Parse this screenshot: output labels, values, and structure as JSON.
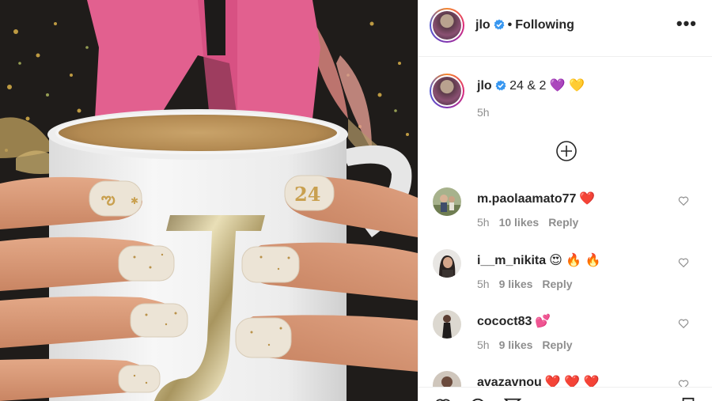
{
  "post": {
    "author": "jlo",
    "follow_status": "Following",
    "separator": "•",
    "more_glyph": "•••",
    "caption_text": "24 & 2 💜 💛",
    "caption_time": "5h"
  },
  "comments": [
    {
      "username": "m.paolaamato77",
      "emoji": "❤️",
      "time": "5h",
      "likes": "10 likes",
      "reply": "Reply"
    },
    {
      "username": "i__m_nikita",
      "emoji": "😍 🔥 🔥",
      "time": "5h",
      "likes": "9 likes",
      "reply": "Reply"
    },
    {
      "username": "cococt83",
      "emoji": "💕",
      "time": "5h",
      "likes": "9 likes",
      "reply": "Reply"
    },
    {
      "username": "avazavnou",
      "emoji": "❤️ ❤️ ❤️",
      "time": "",
      "likes": "",
      "reply": ""
    }
  ],
  "colors": {
    "verified_blue": "#3897f0",
    "muted_text": "#8e8e8e",
    "divider": "#efefef"
  },
  "icons": [
    "verified-badge",
    "more-options",
    "load-more-plus",
    "heart-outline",
    "like-icon",
    "comment-icon",
    "share-icon",
    "save-icon"
  ]
}
